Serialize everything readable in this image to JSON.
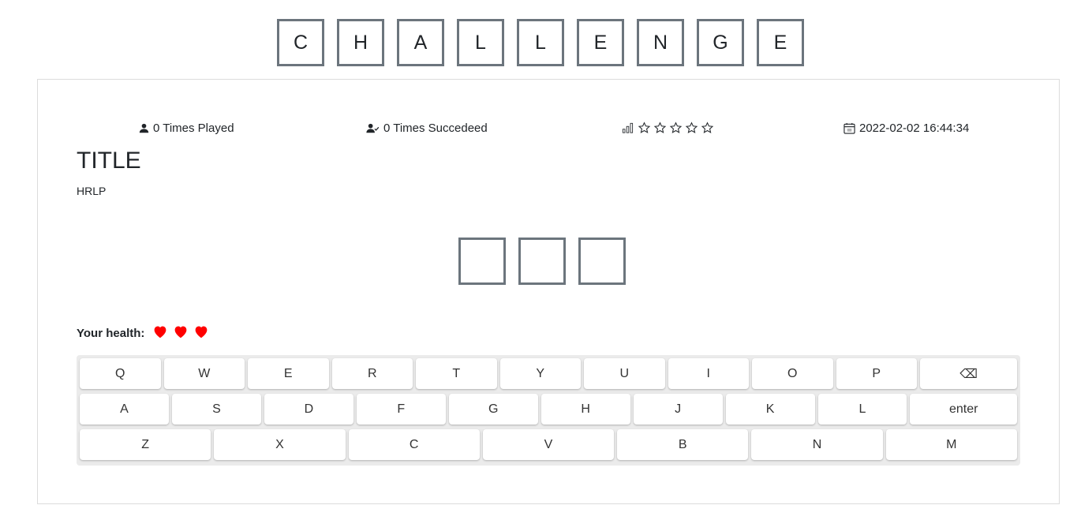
{
  "title_tiles": [
    "C",
    "H",
    "A",
    "L",
    "L",
    "E",
    "N",
    "G",
    "E"
  ],
  "stats": {
    "played": "0 Times Played",
    "succeeded": "0 Times Succedeed",
    "date": "2022-02-02 16:44:34",
    "difficulty_rating": 0,
    "difficulty_max": 5
  },
  "challenge": {
    "title": "TITLE",
    "subtitle": "HRLP"
  },
  "answer_tiles": [
    "",
    "",
    ""
  ],
  "health": {
    "label": "Your health:",
    "hearts": 3,
    "heart_color": "#ff0000"
  },
  "keyboard": {
    "row1": [
      "Q",
      "W",
      "E",
      "R",
      "T",
      "Y",
      "U",
      "I",
      "O",
      "P",
      "⌫"
    ],
    "row2": [
      "A",
      "S",
      "D",
      "F",
      "G",
      "H",
      "J",
      "K",
      "L",
      "enter"
    ],
    "row3": [
      "Z",
      "X",
      "C",
      "V",
      "B",
      "N",
      "M"
    ]
  }
}
